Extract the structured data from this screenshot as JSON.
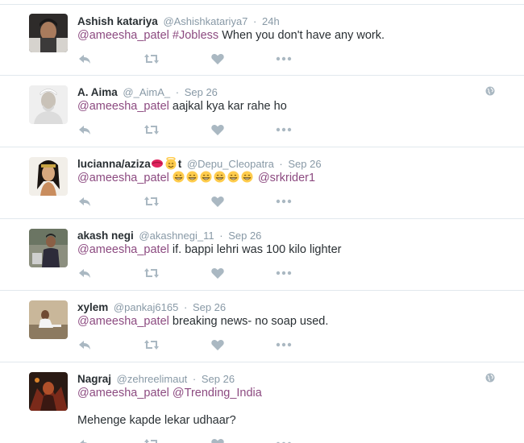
{
  "colors": {
    "link": "#8c4a80",
    "name": "#292f33",
    "meta": "#8899a6",
    "action": "#aab8c2",
    "divider": "#e1e8ed"
  },
  "icons": {
    "reply": "reply-icon",
    "retweet": "retweet-icon",
    "like": "heart-icon",
    "more": "more-icon",
    "globe": "globe-icon"
  },
  "tweets": [
    {
      "name": "Ashish katariya",
      "handle": "@Ashishkatariya7",
      "separator": "·",
      "time": "24h",
      "mention": "@ameesha_patel",
      "hashtag": "#Jobless",
      "text": " When you don't have any work."
    },
    {
      "name": "A. Aima",
      "handle": "@_AimA_",
      "separator": "·",
      "time": "Sep 26",
      "mention": "@ameesha_patel",
      "text": " aajkal kya kar rahe ho"
    },
    {
      "name": "lucianna/aziza",
      "name_suffix": "t",
      "handle": "@Depu_Cleopatra",
      "separator": "·",
      "time": "Sep 26",
      "mention": "@ameesha_patel",
      "emoji_count": 6,
      "mention2": "@srkrider1"
    },
    {
      "name": "akash negi",
      "handle": "@akashnegi_11",
      "separator": "·",
      "time": "Sep 26",
      "mention": "@ameesha_patel",
      "text": " if. bappi lehri was 100 kilo lighter"
    },
    {
      "name": "xylem",
      "handle": "@pankaj6165",
      "separator": "·",
      "time": "Sep 26",
      "mention": "@ameesha_patel",
      "text": " breaking news- no soap used."
    },
    {
      "name": "Nagraj",
      "handle": "@zehreelimaut",
      "separator": "·",
      "time": "Sep 26",
      "mention": "@ameesha_patel",
      "mention2": "@Trending_India",
      "text2": "Mehenge kapde lekar udhaar?"
    }
  ]
}
